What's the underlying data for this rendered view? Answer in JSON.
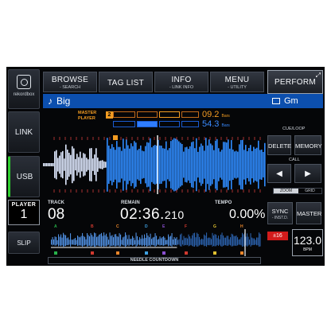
{
  "left": {
    "rekordbox_label": "rekordbox",
    "link_label": "LINK",
    "usb_label": "USB",
    "player_label": "PLAYER",
    "player_number": "1",
    "slip_label": "SLIP"
  },
  "top_menu": {
    "browse": {
      "label": "BROWSE",
      "sub": "- SEARCH"
    },
    "tag_list": {
      "label": "TAG LIST"
    },
    "info": {
      "label": "INFO",
      "sub": "- LINK INFO"
    },
    "menu": {
      "label": "MENU",
      "sub": "- UTILITY"
    },
    "perform": {
      "label": "PERFORM"
    }
  },
  "track_title": "Big",
  "key": "Gm",
  "sync_panel": {
    "master_label": "MASTER",
    "player_label": "PLAYER",
    "master_player_number": "2",
    "bars_a_value": "09.2",
    "bars_a_unit": "Bars",
    "bars_b_value": "54.3",
    "bars_b_unit": "Bars"
  },
  "cue_loop": {
    "title": "CUE/LOOP",
    "delete_label": "DELETE",
    "memory_label": "MEMORY",
    "call_label": "CALL",
    "prev_glyph": "◀",
    "next_glyph": "▶",
    "zoom_label": "ZOOM",
    "grid_label": "GRID"
  },
  "info_row": {
    "track_caption": "TRACK",
    "track_value": "08",
    "remain_caption": "REMAIN",
    "remain_value": "02:36.",
    "remain_ms": "210",
    "tempo_caption": "TEMPO",
    "tempo_value": "0.00%"
  },
  "overview": {
    "needle_label": "NEEDLE COUNTDOWN",
    "hot_cues": [
      "A",
      "B",
      "C",
      "D",
      "E",
      "F",
      "G",
      "H"
    ],
    "played_fraction": 0.6
  },
  "right_controls": {
    "sync_label": "SYNC",
    "sync_sub": "- INST.D.",
    "master_label": "MASTER",
    "pitch_range": "±16",
    "bpm_value": "123.0",
    "bpm_unit": "BPM"
  },
  "colors": {
    "wave_blue": "#2f8cff",
    "accent_orange": "#f39c22",
    "title_bar_blue": "#0c4fae",
    "usb_active_green": "#2fd02f"
  }
}
